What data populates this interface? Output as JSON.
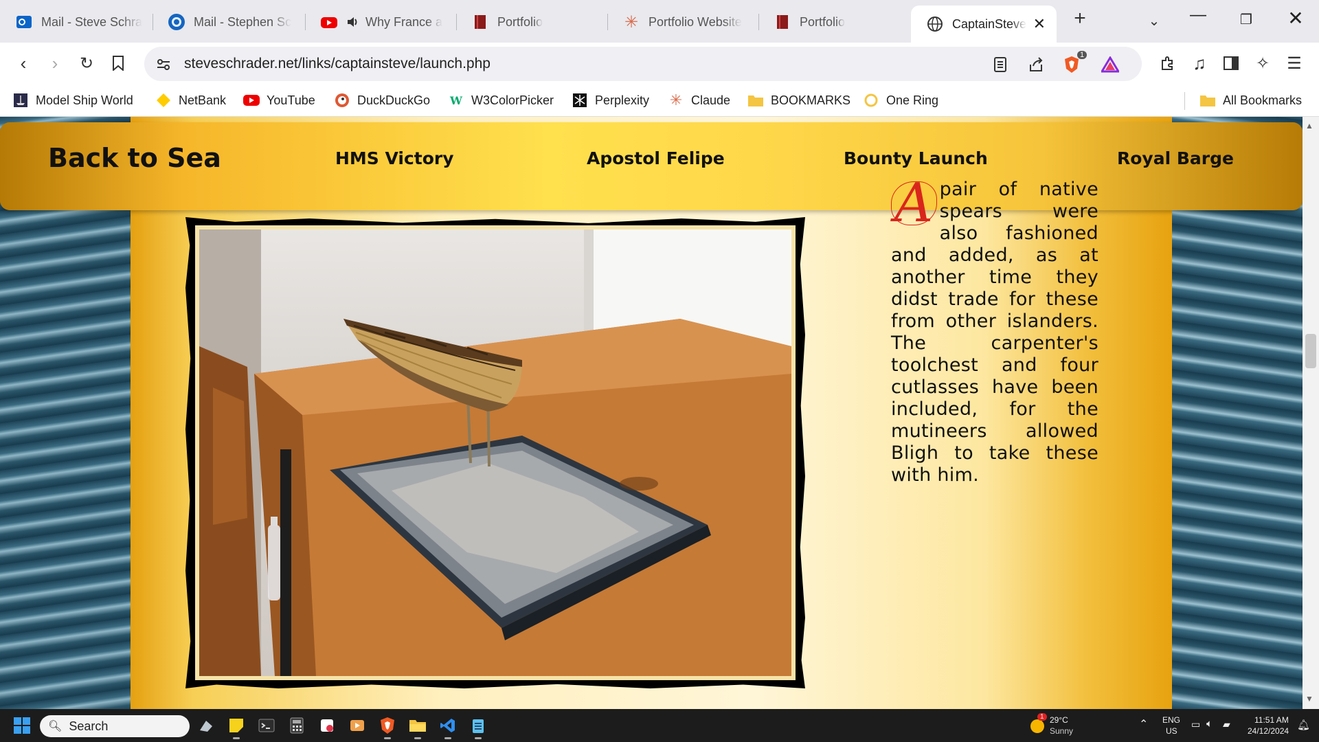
{
  "tabs": [
    {
      "title": "Mail - Steve Schra",
      "icon": "outlook-icon"
    },
    {
      "title": "Mail - Stephen Sc",
      "icon": "mail-app-icon"
    },
    {
      "title": "Why France a",
      "icon": "youtube-icon"
    },
    {
      "title": "Portfolio",
      "icon": "book-icon"
    },
    {
      "title": "Portfolio Website",
      "icon": "claude-icon"
    },
    {
      "title": "Portfolio",
      "icon": "book-icon"
    },
    {
      "title": "CaptainSteve",
      "icon": "globe-icon",
      "active": true
    }
  ],
  "address": {
    "url": "steveschrader.net/links/captainsteve/launch.php",
    "shield_count": "1"
  },
  "bookmarks": [
    {
      "label": "Model Ship World",
      "icon": "ship-icon"
    },
    {
      "label": "NetBank",
      "icon": "diamond-icon"
    },
    {
      "label": "YouTube",
      "icon": "youtube-icon"
    },
    {
      "label": "DuckDuckGo",
      "icon": "duck-icon"
    },
    {
      "label": "W3ColorPicker",
      "icon": "w3-icon"
    },
    {
      "label": "Perplexity",
      "icon": "perplexity-icon"
    },
    {
      "label": "Claude",
      "icon": "claude-icon"
    },
    {
      "label": "BOOKMARKS",
      "icon": "folder-icon"
    },
    {
      "label": "One Ring",
      "icon": "ring-icon"
    }
  ],
  "all_bookmarks": "All Bookmarks",
  "site": {
    "brand": "Back to Sea",
    "nav": [
      "HMS Victory",
      "Apostol Felipe",
      "Bounty Launch",
      "Royal Barge"
    ],
    "dropcap": "A",
    "article_text": "pair of native spears were also fashioned and added, as at another time they didst trade for these from other islanders. The carpenter's toolchest and four cutlasses have been included, for the mutineers allowed Bligh to take these with him."
  },
  "taskbar": {
    "search_placeholder": "Search",
    "weather_temp": "29°C",
    "weather_desc": "Sunny",
    "weather_badge": "1",
    "lang_top": "ENG",
    "lang_bottom": "US",
    "time": "11:51 AM",
    "date": "24/12/2024"
  }
}
